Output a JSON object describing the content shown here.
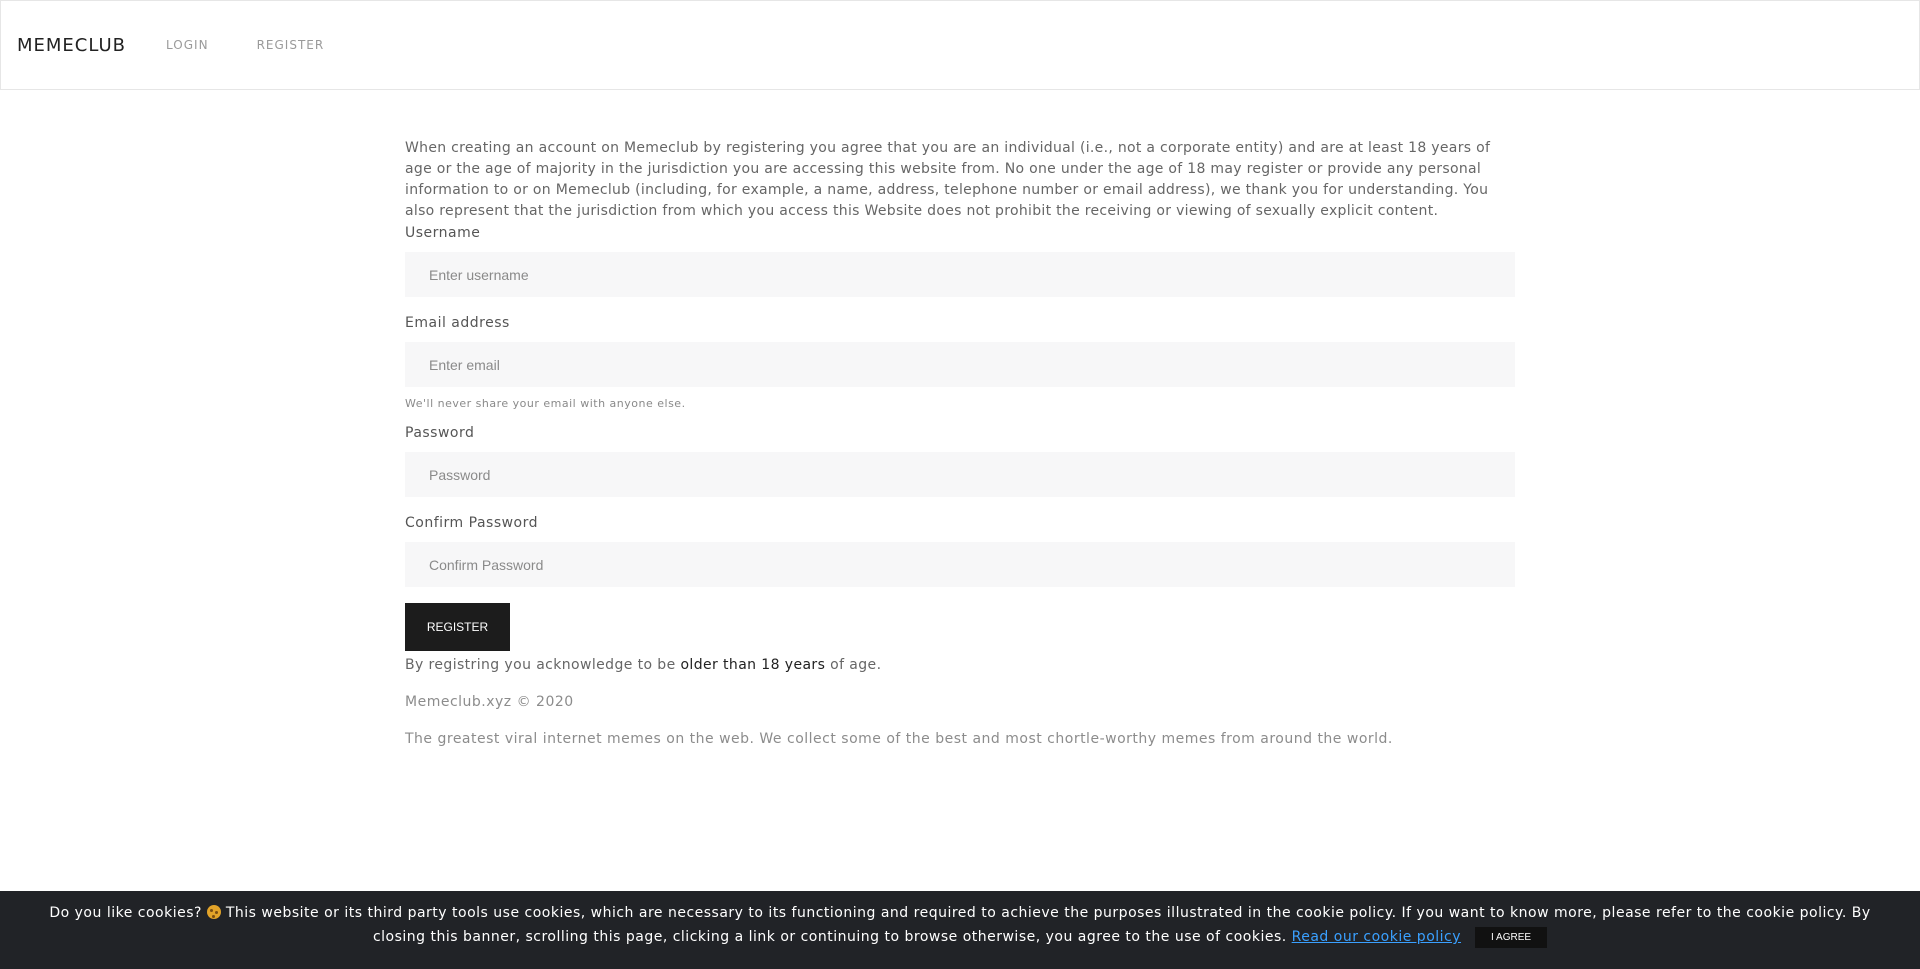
{
  "nav": {
    "brand": "MEMECLUB",
    "links": [
      "LOGIN",
      "REGISTER"
    ]
  },
  "intro": "When creating an account on Memeclub by registering you agree that you are an individual (i.e., not a corporate entity) and are at least 18 years of age or the age of majority in the jurisdiction you are accessing this website from. No one under the age of 18 may register or provide any personal information to or on Memeclub (including, for example, a name, address, telephone number or email address), we thank you for understanding. You also represent that the jurisdiction from which you access this Website does not prohibit the receiving or viewing of sexually explicit content.",
  "form": {
    "username": {
      "label": "Username",
      "placeholder": "Enter username",
      "value": ""
    },
    "email": {
      "label": "Email address",
      "placeholder": "Enter email",
      "value": "",
      "helper": "We'll never share your email with anyone else."
    },
    "password": {
      "label": "Password",
      "placeholder": "Password",
      "value": ""
    },
    "confirm": {
      "label": "Confirm Password",
      "placeholder": "Confirm Password",
      "value": ""
    },
    "submit_label": "REGISTER"
  },
  "acknowledge": {
    "before": "By registring you acknowledge to be ",
    "emphasis": "older than 18 years",
    "after": " of age."
  },
  "footer": {
    "copyright": "Memeclub.xyz © 2020",
    "tagline": "The greatest viral internet memes on the web. We collect some of the best and most chortle-worthy memes from around the world."
  },
  "cookie": {
    "text_before_icon": "Do you like cookies? ",
    "icon": "cookie-icon",
    "text": " This website or its third party tools use cookies, which are necessary to its functioning and required to achieve the purposes illustrated in the cookie policy. If you want to know more, please refer to the cookie policy. By closing this banner, scrolling this page, clicking a link or continuing to browse otherwise, you agree to the use of cookies. ",
    "link_label": "Read our cookie policy",
    "agree_label": "I AGREE"
  }
}
